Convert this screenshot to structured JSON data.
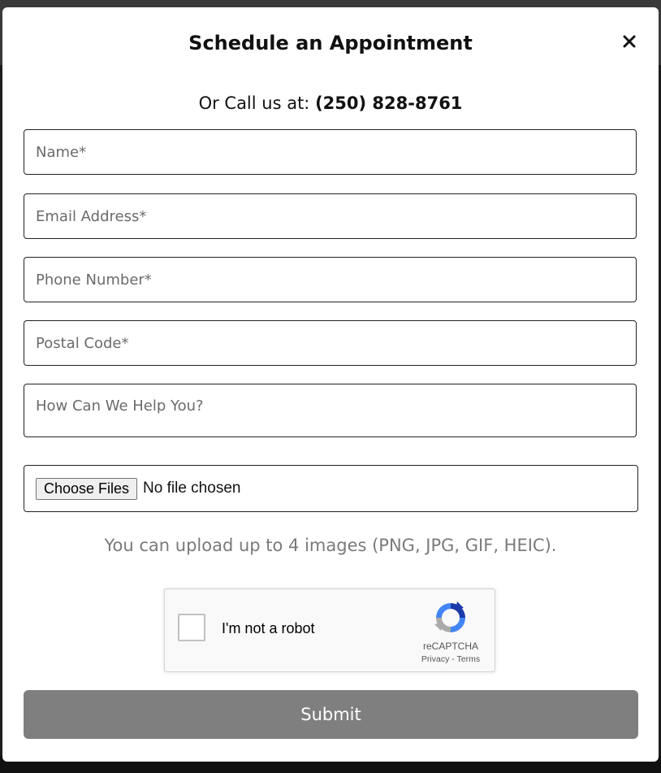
{
  "modal": {
    "title": "Schedule an Appointment",
    "close_icon": "close-icon",
    "call_prefix": "Or Call us at:",
    "phone_number": "(250) 828-8761"
  },
  "form": {
    "name_placeholder": "Name*",
    "email_placeholder": "Email Address*",
    "phone_placeholder": "Phone Number*",
    "postal_placeholder": "Postal Code*",
    "help_placeholder": "How Can We Help You?",
    "file_button": "Choose Files",
    "file_status": "No file chosen",
    "upload_note": "You can upload up to 4 images (PNG, JPG, GIF, HEIC).",
    "submit_label": "Submit"
  },
  "recaptcha": {
    "label": "I'm not a robot",
    "brand": "reCAPTCHA",
    "privacy": "Privacy",
    "separator": "-",
    "terms": "Terms",
    "logo_icon": "recaptcha-logo-icon"
  },
  "colors": {
    "submit_bg": "#7f7f7f",
    "text": "#111111",
    "placeholder": "#6b6b6b"
  }
}
